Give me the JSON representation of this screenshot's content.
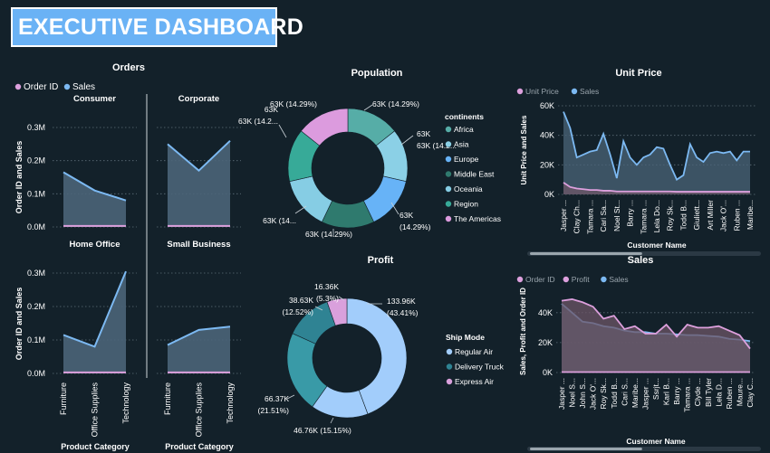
{
  "header": {
    "title": "EXECUTIVE DASHBOARD"
  },
  "theme": {
    "background": "#13212a",
    "title_bg": "#6ab2f5",
    "pink": "#dda0dd",
    "blue": "#7cb9f2",
    "area": "#4b6478"
  },
  "orders_panel": {
    "title": "Orders",
    "legend": [
      "Order ID",
      "Sales"
    ],
    "y_axis_label": "Order ID and Sales",
    "x_axis_label": "Product Category",
    "y_ticks": [
      "0.0M",
      "0.1M",
      "0.2M",
      "0.3M"
    ],
    "categories": [
      "Furniture",
      "Office Supplies",
      "Technology"
    ]
  },
  "chart_data": [
    {
      "type": "area",
      "title": "Orders",
      "subtitle": "Consumer",
      "categories": [
        "Furniture",
        "Office Supplies",
        "Technology"
      ],
      "series": [
        {
          "name": "Sales",
          "values": [
            0.165,
            0.11,
            0.08
          ]
        },
        {
          "name": "Order ID",
          "values": [
            0.003,
            0.003,
            0.003
          ]
        }
      ],
      "ylim": [
        0,
        0.3
      ],
      "ylabel": "Order ID and Sales",
      "xlabel": "Product Category"
    },
    {
      "type": "area",
      "title": "Orders",
      "subtitle": "Corporate",
      "categories": [
        "Furniture",
        "Office Supplies",
        "Technology"
      ],
      "series": [
        {
          "name": "Sales",
          "values": [
            0.25,
            0.17,
            0.26
          ]
        },
        {
          "name": "Order ID",
          "values": [
            0.003,
            0.003,
            0.003
          ]
        }
      ],
      "ylim": [
        0,
        0.3
      ]
    },
    {
      "type": "area",
      "title": "Orders",
      "subtitle": "Home Office",
      "categories": [
        "Furniture",
        "Office Supplies",
        "Technology"
      ],
      "series": [
        {
          "name": "Sales",
          "values": [
            0.115,
            0.08,
            0.305
          ]
        },
        {
          "name": "Order ID",
          "values": [
            0.003,
            0.003,
            0.003
          ]
        }
      ],
      "ylim": [
        0,
        0.3
      ],
      "ylabel": "Order ID and Sales",
      "xlabel": "Product Category"
    },
    {
      "type": "area",
      "title": "Orders",
      "subtitle": "Small Business",
      "categories": [
        "Furniture",
        "Office Supplies",
        "Technology"
      ],
      "series": [
        {
          "name": "Sales",
          "values": [
            0.085,
            0.13,
            0.14
          ]
        },
        {
          "name": "Order ID",
          "values": [
            0.003,
            0.003,
            0.003
          ]
        }
      ],
      "ylim": [
        0,
        0.3
      ],
      "xlabel": "Product Category"
    },
    {
      "type": "pie",
      "title": "Population",
      "legend_title": "continents",
      "slices": [
        {
          "label": "Africa",
          "value": 63,
          "text": "63K (14.29%)",
          "color": "#56ada7"
        },
        {
          "label": "Asia",
          "value": 63,
          "text": "63K (14.2...",
          "color": "#8bd0e6"
        },
        {
          "label": "Europe",
          "value": 63,
          "text": "63K (14.29%)",
          "color": "#67b3f7"
        },
        {
          "label": "Middle East",
          "value": 63,
          "text": "63K (14.29%)",
          "color": "#2f7a6e"
        },
        {
          "label": "Oceania",
          "value": 63,
          "text": "63K (14...",
          "color": "#86cde4"
        },
        {
          "label": "Region",
          "value": 63,
          "text": "63K (14.2...",
          "color": "#37aa98"
        },
        {
          "label": "The Americas",
          "value": 63,
          "text": "63K (14.29%)",
          "color": "#dc9bde"
        }
      ]
    },
    {
      "type": "pie",
      "title": "Profit",
      "legend_title": "Ship Mode",
      "slices": [
        {
          "label": "Regular Air",
          "value": 133.96,
          "text": "133.96K (43.41%)",
          "color": "#a2cdfb"
        },
        {
          "label": "",
          "value": 46.76,
          "text": "46.76K (15.15%)",
          "color": "#a2cdfb"
        },
        {
          "label": "",
          "value": 66.37,
          "text": "66.37K (21.51%)",
          "color": "#399aa7"
        },
        {
          "label": "Delivery Truck",
          "value": 38.63,
          "text": "38.63K (12.52%)",
          "color": "#2f8393"
        },
        {
          "label": "Express Air",
          "value": 16.36,
          "text": "16.36K (5.3%)",
          "color": "#d9a0dc"
        }
      ]
    },
    {
      "type": "area",
      "title": "Unit Price",
      "categories": [
        "Jasper ...",
        "",
        "Clay Ch...",
        "",
        "Tamara ...",
        "",
        "Cari Sa...",
        "",
        "Noel St...",
        "",
        "Barry ...",
        "",
        "Tamara ...",
        "",
        "Lela Do...",
        "",
        "Roy Sk...",
        "",
        "Todd B...",
        "",
        "Giuliett...",
        "",
        "Art Miller",
        "",
        "Jack O'...",
        "",
        "Ruben ...",
        "",
        "Maribe..."
      ],
      "series": [
        {
          "name": "Sales",
          "values": [
            56,
            45,
            25,
            27,
            29,
            30,
            41,
            27,
            11,
            36,
            25,
            20,
            25,
            27,
            32,
            31,
            20,
            10,
            13,
            34,
            25,
            22,
            28,
            29,
            28,
            29,
            23,
            29,
            29
          ]
        },
        {
          "name": "Unit Price",
          "values": [
            8,
            5,
            4,
            3.5,
            3,
            3,
            2.5,
            2.5,
            2,
            2,
            2,
            2,
            2,
            2,
            2,
            2,
            2,
            1.8,
            1.8,
            1.8,
            1.8,
            1.8,
            1.8,
            1.8,
            1.8,
            1.8,
            1.8,
            1.8,
            1.8
          ]
        }
      ],
      "y_ticks": [
        "0K",
        "20K",
        "40K",
        "60K"
      ],
      "ylim": [
        0,
        60
      ],
      "ylabel": "Unit Price and Sales",
      "xlabel": "Customer Name"
    },
    {
      "type": "area",
      "title": "Sales",
      "categories": [
        "Jasper ...",
        "Noel S...",
        "John S...",
        "Jack O'...",
        "Roy Sk...",
        "Todd B...",
        "Cari S...",
        "Maribe...",
        "Jasper ...",
        "Ssrjt...",
        "Karl B...",
        "Barry ...",
        "Tamara ...",
        "Clyde ...",
        "Bill Tyler",
        "Lela D...",
        "Ruben ...",
        "Maure...",
        "Clay C..."
      ],
      "series": [
        {
          "name": "Sales",
          "values": [
            46,
            40,
            34,
            33,
            31,
            30,
            28,
            27,
            27,
            26,
            26,
            25.5,
            25,
            25,
            24.5,
            24,
            22.5,
            22,
            21
          ]
        },
        {
          "name": "Profit",
          "values": [
            48,
            49,
            47,
            44,
            36,
            38,
            29,
            31,
            26,
            26,
            32,
            24,
            32,
            30,
            30,
            31,
            28,
            25,
            16
          ]
        },
        {
          "name": "Order ID",
          "values": [
            0.3,
            0.3,
            0.3,
            0.3,
            0.3,
            0.3,
            0.3,
            0.3,
            0.3,
            0.3,
            0.3,
            0.3,
            0.3,
            0.3,
            0.3,
            0.3,
            0.3,
            0.3,
            0.3
          ]
        }
      ],
      "y_ticks": [
        "0K",
        "20K",
        "40K"
      ],
      "ylim": [
        0,
        55
      ],
      "ylabel": "Sales, Profit and Order ID",
      "xlabel": "Customer Name"
    }
  ]
}
